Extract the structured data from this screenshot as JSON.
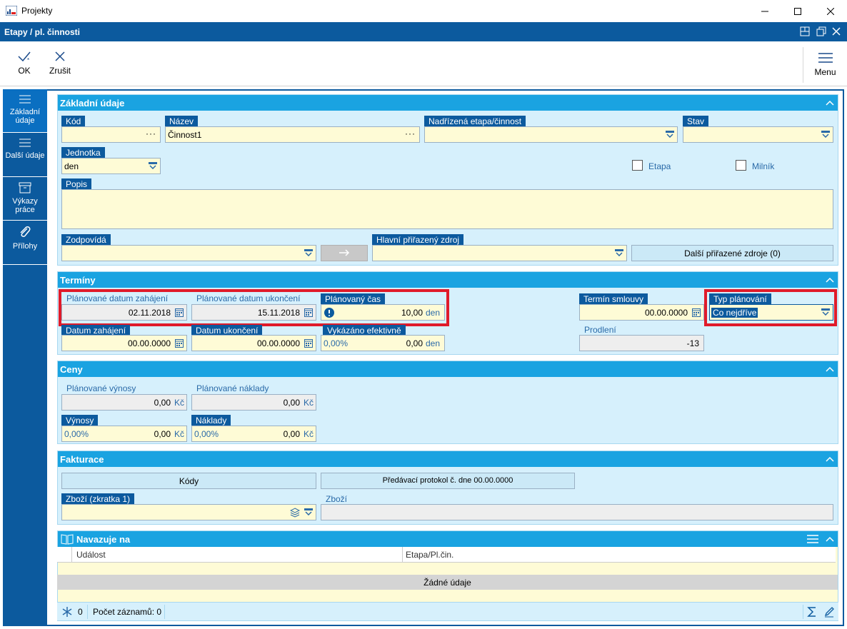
{
  "window": {
    "title": "Projekty"
  },
  "header": {
    "title": "Etapy / pl. činnosti"
  },
  "toolbar": {
    "ok": "OK",
    "cancel": "Zrušit",
    "menu": "Menu"
  },
  "sidebar": {
    "items": [
      "Základní údaje",
      "Další údaje",
      "Výkazy práce",
      "Přílohy"
    ]
  },
  "basic": {
    "title": "Základní údaje",
    "kod_label": "Kód",
    "kod_value": "",
    "nazev_label": "Název",
    "nazev_value": "Činnost1",
    "parent_label": "Nadřízená etapa/činnost",
    "parent_value": "",
    "stav_label": "Stav",
    "stav_value": "",
    "jednotka_label": "Jednotka",
    "jednotka_value": "den",
    "etapa_label": "Etapa",
    "milnik_label": "Milník",
    "popis_label": "Popis",
    "popis_value": "",
    "zodpovida_label": "Zodpovídá",
    "zodpovida_value": "",
    "zdroj_label": "Hlavní přiřazený zdroj",
    "zdroj_value": "",
    "dalsi_zdroje_button": "Další přiřazené zdroje (0)"
  },
  "terminy": {
    "title": "Termíny",
    "plan_start_label": "Plánované datum zahájení",
    "plan_start_value": "02.11.2018",
    "plan_end_label": "Plánované datum ukončení",
    "plan_end_value": "15.11.2018",
    "plan_cas_label": "Plánovaný čas",
    "plan_cas_value": "10,00",
    "plan_cas_unit": "den",
    "termin_smlouvy_label": "Termín smlouvy",
    "termin_smlouvy_value": "00.00.0000",
    "typ_planovani_label": "Typ plánování",
    "typ_planovani_value": "Co nejdříve",
    "start_label": "Datum zahájení",
    "start_value": "00.00.0000",
    "end_label": "Datum ukončení",
    "end_value": "00.00.0000",
    "vykazano_label": "Vykázáno efektivně",
    "vykazano_pct": "0,00%",
    "vykazano_value": "0,00",
    "vykazano_unit": "den",
    "prodleni_label": "Prodlení",
    "prodleni_value": "-13"
  },
  "ceny": {
    "title": "Ceny",
    "plan_vynosy_label": "Plánované výnosy",
    "plan_vynosy_value": "0,00",
    "plan_naklady_label": "Plánované náklady",
    "plan_naklady_value": "0,00",
    "vynosy_label": "Výnosy",
    "vynosy_pct": "0,00%",
    "vynosy_value": "0,00",
    "naklady_label": "Náklady",
    "naklady_pct": "0,00%",
    "naklady_value": "0,00",
    "currency": "Kč"
  },
  "fakturace": {
    "title": "Fakturace",
    "kody_button": "Kódy",
    "protokol_button": "Předávací protokol č.  dne 00.00.0000",
    "zbozi_zkratka_label": "Zboží (zkratka 1)",
    "zbozi_zkratka_value": "",
    "zbozi_label": "Zboží",
    "zbozi_value": ""
  },
  "navazuje": {
    "title": "Navazuje na",
    "columns": [
      "Událost",
      "Etapa/Pl.čin."
    ],
    "empty": "Žádné údaje",
    "footer_count": "0",
    "footer_records": "Počet záznamů: 0"
  }
}
